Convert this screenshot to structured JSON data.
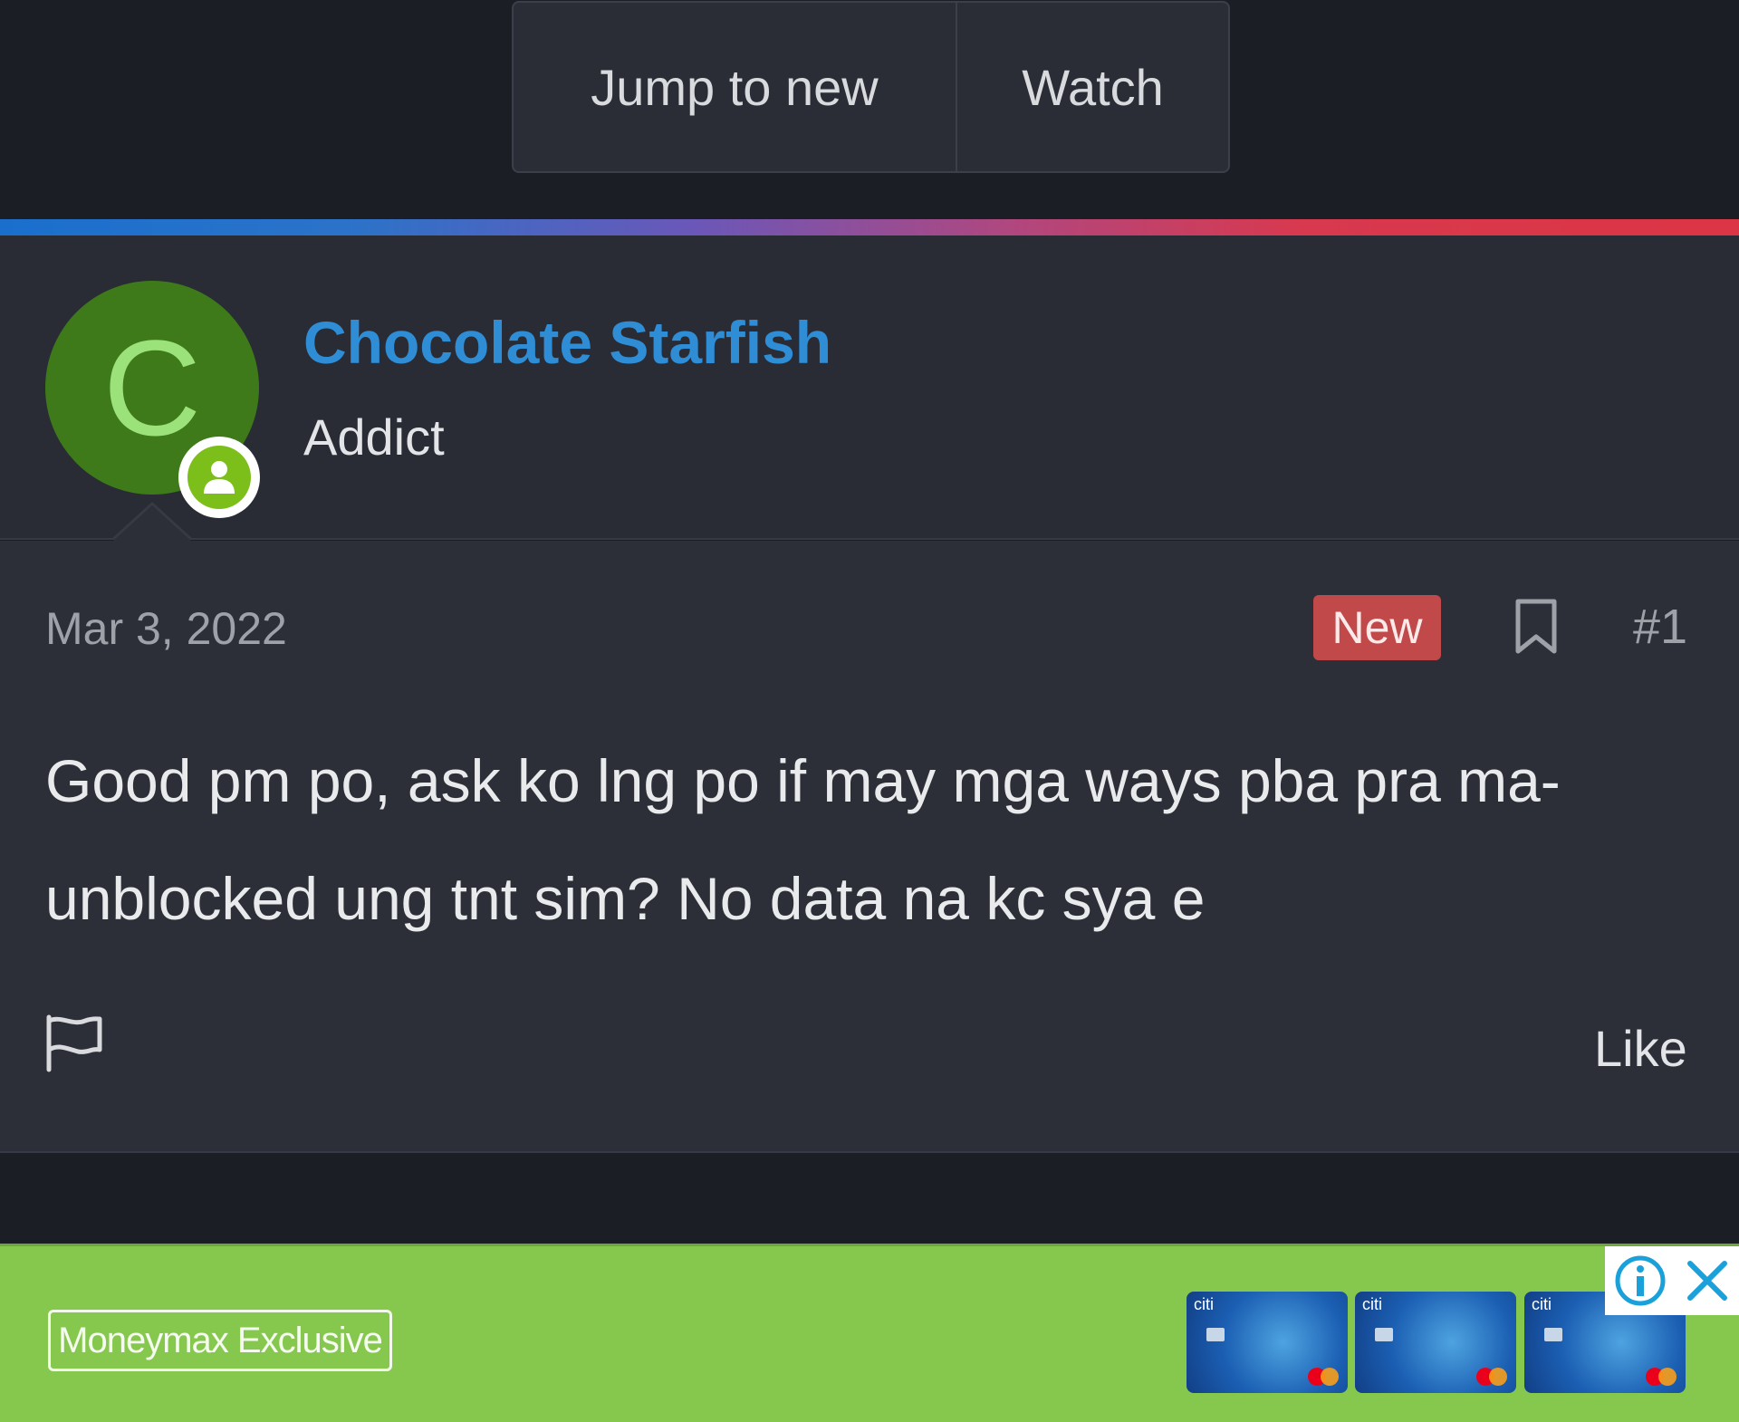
{
  "thread_actions": {
    "jump_label": "Jump to new",
    "watch_label": "Watch"
  },
  "user": {
    "avatar_letter": "C",
    "name": "Chocolate Starfish",
    "title": "Addict",
    "avatar_color": "#3e7a1a",
    "online_icon": "user-online-icon"
  },
  "post": {
    "date": "Mar 3, 2022",
    "badge": "New",
    "number": "#1",
    "text": "Good pm po, ask ko lng po if may mga ways pba pra ma-unblocked ung tnt sim? No data na kc sya e",
    "like_label": "Like",
    "bookmark_icon": "bookmark-icon",
    "report_icon": "flag-icon"
  },
  "ad": {
    "logo_text": "Moneymax Exclusive",
    "cards": [
      {
        "brand": "citi"
      },
      {
        "brand": "citi"
      },
      {
        "brand": "citi"
      }
    ],
    "background": "#86c84e"
  },
  "colors": {
    "username": "#2f8dd6",
    "new_badge": "#c24949",
    "page_bg": "#1c1e25",
    "post_bg": "#2c2f38"
  }
}
